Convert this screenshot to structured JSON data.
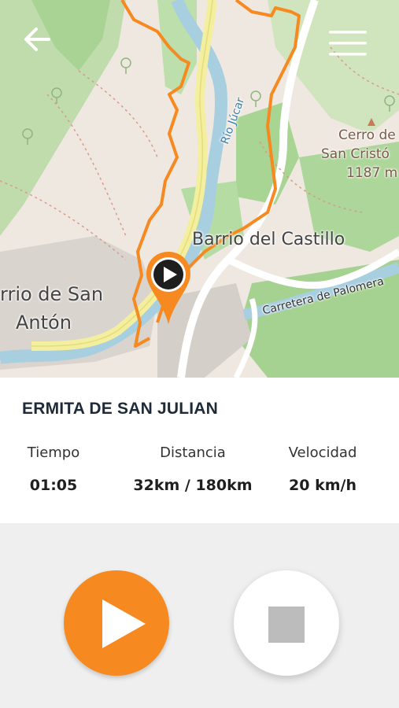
{
  "map": {
    "labels": {
      "river": "Río Júcar",
      "barrio_castillo": "Barrio del Castillo",
      "barrio_san_anton_1": "rrio de San",
      "barrio_san_anton_2": "Antón",
      "carretera": "Carretera de Palomera",
      "cerro_1": "Cerro de",
      "cerro_2": "San Cristó",
      "cerro_3": "1187 m"
    },
    "route_color": "#f6891f"
  },
  "route": {
    "title": "ERMITA DE SAN JULIAN",
    "stats": {
      "time_label": "Tiempo",
      "time_value": "01:05",
      "distance_label": "Distancia",
      "distance_value": "32km / 180km",
      "speed_label": "Velocidad",
      "speed_value": "20 km/h"
    }
  },
  "icons": {
    "back": "arrow-left-icon",
    "menu": "hamburger-menu-icon",
    "marker": "map-marker-play-icon",
    "play": "play-icon",
    "stop": "stop-icon"
  },
  "colors": {
    "accent": "#f6891f",
    "title": "#1f2a38"
  }
}
